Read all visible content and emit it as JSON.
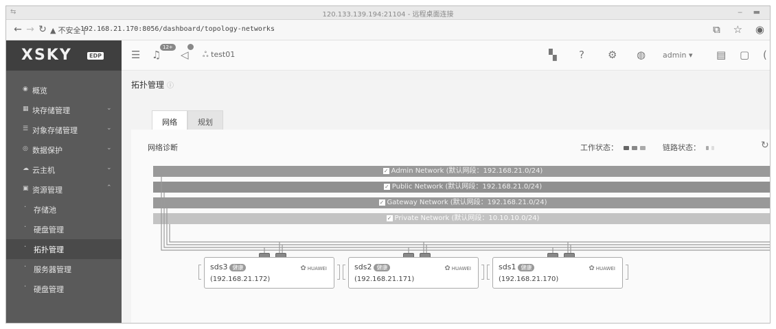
{
  "window": {
    "title": "120.133.139.194:21104 - 远程桌面连接"
  },
  "browser": {
    "security_label": "不安全",
    "url": "192.168.21.170:8056/dashboard/topology-networks"
  },
  "sidebar": {
    "logo": "XSKY",
    "logo_badge": "EDP",
    "items": [
      {
        "label": "概览",
        "icon": "dashboard-icon",
        "expandable": false
      },
      {
        "label": "块存储管理",
        "icon": "block-storage-icon",
        "expandable": true
      },
      {
        "label": "对象存储管理",
        "icon": "object-storage-icon",
        "expandable": true
      },
      {
        "label": "数据保护",
        "icon": "data-protection-icon",
        "expandable": true
      },
      {
        "label": "云主机",
        "icon": "cloud-host-icon",
        "expandable": true
      },
      {
        "label": "资源管理",
        "icon": "resource-management-icon",
        "expandable": true,
        "expanded": true
      },
      {
        "label": "存储池",
        "sub": true
      },
      {
        "label": "硬盘管理",
        "sub": true
      },
      {
        "label": "拓扑管理",
        "sub": true,
        "active": true
      },
      {
        "label": "服务器管理",
        "sub": true
      },
      {
        "label": "硬盘管理",
        "sub": true
      }
    ]
  },
  "header": {
    "user_label": "test01",
    "alerts_badge": "12+",
    "admin_label": "admin"
  },
  "page": {
    "title": "拓扑管理",
    "tabs": [
      {
        "label": "网络",
        "active": true
      },
      {
        "label": "规划",
        "active": false
      }
    ],
    "diag_title": "网络诊断",
    "work_status_label": "工作状态：",
    "link_status_label": "链路状态：",
    "networks": [
      {
        "label": "Admin Network (默认网段：192.168.21.0/24)",
        "checked": true
      },
      {
        "label": "Public Network (默认网段：192.168.21.0/24)",
        "checked": true
      },
      {
        "label": "Gateway Network (默认网段：192.168.21.0/24)",
        "checked": true
      },
      {
        "label": "Private Network (默认网段：10.10.10.0/24)",
        "checked": true
      }
    ],
    "nodes": [
      {
        "name": "sds3",
        "badge": "健康",
        "ip": "(192.168.21.172)",
        "vendor": "HUAWEI"
      },
      {
        "name": "sds2",
        "badge": "健康",
        "ip": "(192.168.21.171)",
        "vendor": "HUAWEI"
      },
      {
        "name": "sds1",
        "badge": "健康",
        "ip": "(192.168.21.170)",
        "vendor": "HUAWEI"
      }
    ]
  },
  "colors": {
    "sidebar_bg": "#5a5a5a",
    "logo_bg": "#3f3f3f",
    "network_bar": "#999999",
    "private_network_bar": "#c3c3c3"
  }
}
